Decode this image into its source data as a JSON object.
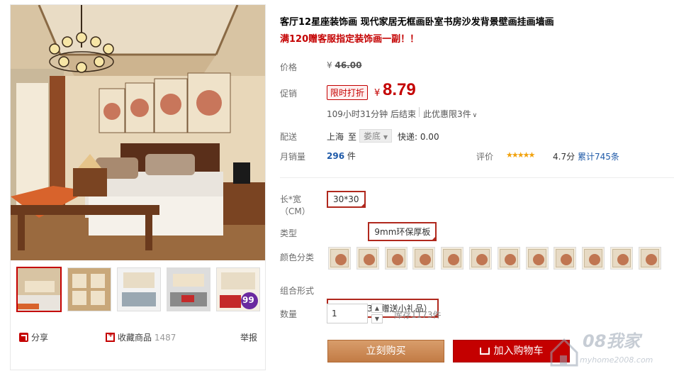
{
  "product": {
    "title": "客厅12星座装饰画 现代家居无框画卧室书房沙发背景壁画挂画墙画",
    "promo": "满120赠客服指定装饰画一副！！"
  },
  "price": {
    "label": "价格",
    "currency": "¥",
    "original": "46.00",
    "promo_label": "促销",
    "promo_tag": "限时打折",
    "current": "8.79",
    "countdown": "109小时31分钟 后结束",
    "limit": "此优惠限3件"
  },
  "shipping": {
    "label": "配送",
    "from": "上海",
    "to_word": "至",
    "destination": "娄底",
    "express": "快递: 0.00"
  },
  "sales": {
    "label": "月销量",
    "count": "296",
    "unit": "件",
    "rating_label": "评价",
    "stars": "★★★★★",
    "score": "4.7分",
    "reviews": "累计745条"
  },
  "options": {
    "size_label": "长*宽",
    "size_unit": "（CM）",
    "size_value": "30*30",
    "type_label": "类型",
    "type_value": "9mm环保厚板",
    "color_label": "颜色分类",
    "color_count": 12,
    "combo_label": "组合形式",
    "combo_value": "单个（拍3幅赠送小礼品）"
  },
  "quantity": {
    "label": "数量",
    "value": "1",
    "stock": "库存1173件"
  },
  "actions": {
    "buy_now": "立刻购买",
    "add_cart": "加入购物车"
  },
  "gallery": {
    "share": "分享",
    "favorite": "收藏商品",
    "favorite_count": "1487",
    "report": "举报",
    "badge_text": "99"
  },
  "watermark": {
    "brand": "08我家",
    "url": "myhome2008.com"
  },
  "colors": {
    "accent": "#c40000",
    "buy_button": "#c98450"
  }
}
